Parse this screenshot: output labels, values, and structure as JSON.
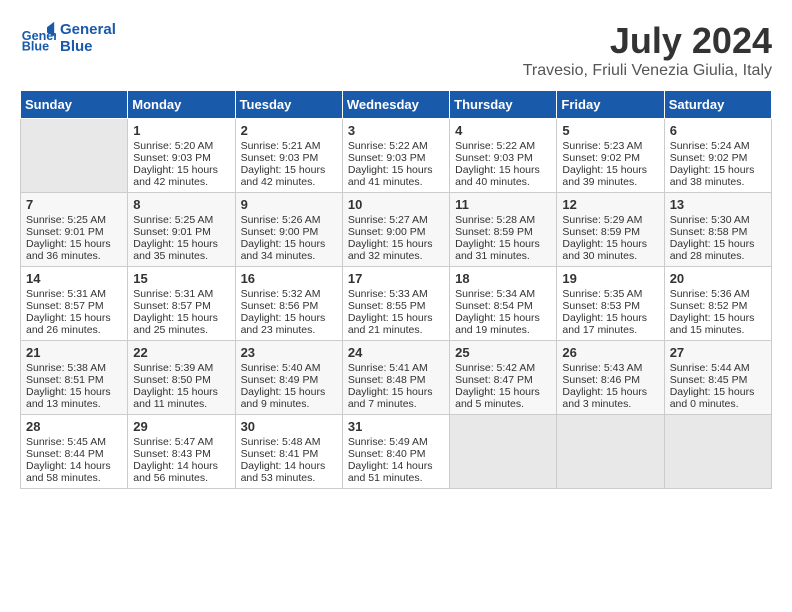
{
  "logo": {
    "line1": "General",
    "line2": "Blue"
  },
  "title": "July 2024",
  "subtitle": "Travesio, Friuli Venezia Giulia, Italy",
  "weekdays": [
    "Sunday",
    "Monday",
    "Tuesday",
    "Wednesday",
    "Thursday",
    "Friday",
    "Saturday"
  ],
  "weeks": [
    [
      {
        "day": "",
        "empty": true
      },
      {
        "day": "1",
        "rise": "5:20 AM",
        "set": "9:03 PM",
        "daylight": "15 hours and 42 minutes."
      },
      {
        "day": "2",
        "rise": "5:21 AM",
        "set": "9:03 PM",
        "daylight": "15 hours and 42 minutes."
      },
      {
        "day": "3",
        "rise": "5:22 AM",
        "set": "9:03 PM",
        "daylight": "15 hours and 41 minutes."
      },
      {
        "day": "4",
        "rise": "5:22 AM",
        "set": "9:03 PM",
        "daylight": "15 hours and 40 minutes."
      },
      {
        "day": "5",
        "rise": "5:23 AM",
        "set": "9:02 PM",
        "daylight": "15 hours and 39 minutes."
      },
      {
        "day": "6",
        "rise": "5:24 AM",
        "set": "9:02 PM",
        "daylight": "15 hours and 38 minutes."
      }
    ],
    [
      {
        "day": "7",
        "rise": "5:25 AM",
        "set": "9:01 PM",
        "daylight": "15 hours and 36 minutes."
      },
      {
        "day": "8",
        "rise": "5:25 AM",
        "set": "9:01 PM",
        "daylight": "15 hours and 35 minutes."
      },
      {
        "day": "9",
        "rise": "5:26 AM",
        "set": "9:00 PM",
        "daylight": "15 hours and 34 minutes."
      },
      {
        "day": "10",
        "rise": "5:27 AM",
        "set": "9:00 PM",
        "daylight": "15 hours and 32 minutes."
      },
      {
        "day": "11",
        "rise": "5:28 AM",
        "set": "8:59 PM",
        "daylight": "15 hours and 31 minutes."
      },
      {
        "day": "12",
        "rise": "5:29 AM",
        "set": "8:59 PM",
        "daylight": "15 hours and 30 minutes."
      },
      {
        "day": "13",
        "rise": "5:30 AM",
        "set": "8:58 PM",
        "daylight": "15 hours and 28 minutes."
      }
    ],
    [
      {
        "day": "14",
        "rise": "5:31 AM",
        "set": "8:57 PM",
        "daylight": "15 hours and 26 minutes."
      },
      {
        "day": "15",
        "rise": "5:31 AM",
        "set": "8:57 PM",
        "daylight": "15 hours and 25 minutes."
      },
      {
        "day": "16",
        "rise": "5:32 AM",
        "set": "8:56 PM",
        "daylight": "15 hours and 23 minutes."
      },
      {
        "day": "17",
        "rise": "5:33 AM",
        "set": "8:55 PM",
        "daylight": "15 hours and 21 minutes."
      },
      {
        "day": "18",
        "rise": "5:34 AM",
        "set": "8:54 PM",
        "daylight": "15 hours and 19 minutes."
      },
      {
        "day": "19",
        "rise": "5:35 AM",
        "set": "8:53 PM",
        "daylight": "15 hours and 17 minutes."
      },
      {
        "day": "20",
        "rise": "5:36 AM",
        "set": "8:52 PM",
        "daylight": "15 hours and 15 minutes."
      }
    ],
    [
      {
        "day": "21",
        "rise": "5:38 AM",
        "set": "8:51 PM",
        "daylight": "15 hours and 13 minutes."
      },
      {
        "day": "22",
        "rise": "5:39 AM",
        "set": "8:50 PM",
        "daylight": "15 hours and 11 minutes."
      },
      {
        "day": "23",
        "rise": "5:40 AM",
        "set": "8:49 PM",
        "daylight": "15 hours and 9 minutes."
      },
      {
        "day": "24",
        "rise": "5:41 AM",
        "set": "8:48 PM",
        "daylight": "15 hours and 7 minutes."
      },
      {
        "day": "25",
        "rise": "5:42 AM",
        "set": "8:47 PM",
        "daylight": "15 hours and 5 minutes."
      },
      {
        "day": "26",
        "rise": "5:43 AM",
        "set": "8:46 PM",
        "daylight": "15 hours and 3 minutes."
      },
      {
        "day": "27",
        "rise": "5:44 AM",
        "set": "8:45 PM",
        "daylight": "15 hours and 0 minutes."
      }
    ],
    [
      {
        "day": "28",
        "rise": "5:45 AM",
        "set": "8:44 PM",
        "daylight": "14 hours and 58 minutes."
      },
      {
        "day": "29",
        "rise": "5:47 AM",
        "set": "8:43 PM",
        "daylight": "14 hours and 56 minutes."
      },
      {
        "day": "30",
        "rise": "5:48 AM",
        "set": "8:41 PM",
        "daylight": "14 hours and 53 minutes."
      },
      {
        "day": "31",
        "rise": "5:49 AM",
        "set": "8:40 PM",
        "daylight": "14 hours and 51 minutes."
      },
      {
        "day": "",
        "empty": true
      },
      {
        "day": "",
        "empty": true
      },
      {
        "day": "",
        "empty": true
      }
    ]
  ]
}
